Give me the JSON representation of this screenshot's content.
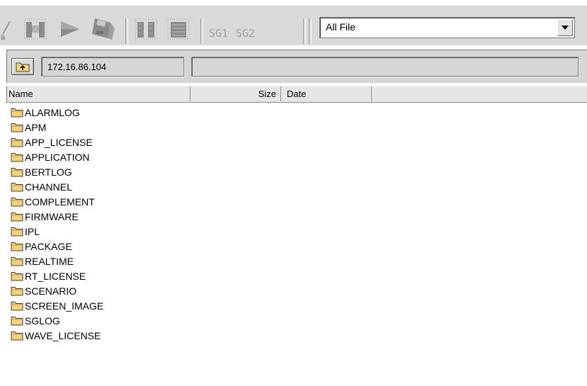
{
  "toolbar": {
    "buttons": [
      {
        "name": "delete-button",
        "icon": "delete-icon"
      },
      {
        "name": "stop-button",
        "icon": "stop-icon"
      },
      {
        "name": "play-button",
        "icon": "play-icon"
      },
      {
        "name": "save-button",
        "icon": "disk-icon"
      },
      {
        "name": "pause-button",
        "icon": "pause-icon"
      },
      {
        "name": "record-button",
        "icon": "block-icon"
      }
    ],
    "sg1_label": "SG1",
    "sg2_label": "SG2",
    "filter_value": "All File"
  },
  "path": {
    "value": "172.16.86.104",
    "status": ""
  },
  "list": {
    "columns": {
      "name": "Name",
      "size": "Size",
      "date": "Date"
    },
    "items": [
      "ALARMLOG",
      "APM",
      "APP_LICENSE",
      "APPLICATION",
      "BERTLOG",
      "CHANNEL",
      "COMPLEMENT",
      "FIRMWARE",
      "IPL",
      "PACKAGE",
      "REALTIME",
      "RT_LICENSE",
      "SCENARIO",
      "SCREEN_IMAGE",
      "SGLOG",
      "WAVE_LICENSE"
    ]
  },
  "colors": {
    "toolbar_bg": "#d9d9d9",
    "folder_fill": "#f5d27a",
    "folder_stroke": "#404040",
    "icon_dark": "#8c8c8c",
    "icon_mid": "#bcbcbc"
  }
}
